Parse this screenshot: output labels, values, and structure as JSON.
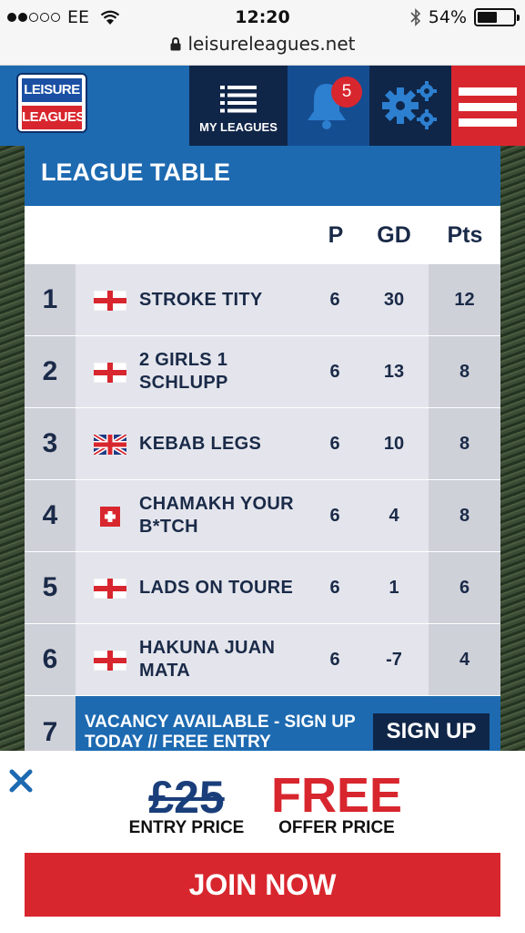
{
  "status_bar": {
    "carrier": "EE",
    "time": "12:20",
    "battery": "54%",
    "battery_level": 0.54,
    "url": "leisureleagues.net",
    "icons": [
      "wifi-icon",
      "bluetooth-icon",
      "battery-icon",
      "lock-icon"
    ]
  },
  "header": {
    "logo_top": "LEISURE",
    "logo_bottom": "LEAGUES",
    "my_leagues_label": "MY LEAGUES",
    "notification_count": "5",
    "icons": [
      "list-icon",
      "bell-icon",
      "gear-icon",
      "hamburger-menu-icon"
    ]
  },
  "table": {
    "title": "LEAGUE TABLE",
    "headers": {
      "p": "P",
      "gd": "GD",
      "pts": "Pts"
    },
    "rows": [
      {
        "rank": "1",
        "flag": "england",
        "team": "STROKE TITY",
        "p": "6",
        "gd": "30",
        "pts": "12"
      },
      {
        "rank": "2",
        "flag": "england",
        "team": "2 GIRLS 1 SCHLUPP",
        "p": "6",
        "gd": "13",
        "pts": "8"
      },
      {
        "rank": "3",
        "flag": "uk",
        "team": "KEBAB LEGS",
        "p": "6",
        "gd": "10",
        "pts": "8"
      },
      {
        "rank": "4",
        "flag": "switzerland",
        "team": "CHAMAKH YOUR B*TCH",
        "p": "6",
        "gd": "4",
        "pts": "8"
      },
      {
        "rank": "5",
        "flag": "england",
        "team": "LADS ON TOURE",
        "p": "6",
        "gd": "1",
        "pts": "6"
      },
      {
        "rank": "6",
        "flag": "england",
        "team": "HAKUNA JUAN MATA",
        "p": "6",
        "gd": "-7",
        "pts": "4"
      }
    ],
    "vacancy": {
      "rank": "7",
      "text": "VACANCY AVAILABLE - SIGN UP TODAY // FREE ENTRY",
      "button": "SIGN UP"
    }
  },
  "offer": {
    "old_price": "£25",
    "old_price_label": "ENTRY PRICE",
    "new_price": "FREE",
    "new_price_label": "OFFER PRICE",
    "join_button": "JOIN NOW"
  },
  "colors": {
    "brand_blue": "#1d6ab1",
    "navy": "#0f2648",
    "brand_red": "#d8262e"
  }
}
